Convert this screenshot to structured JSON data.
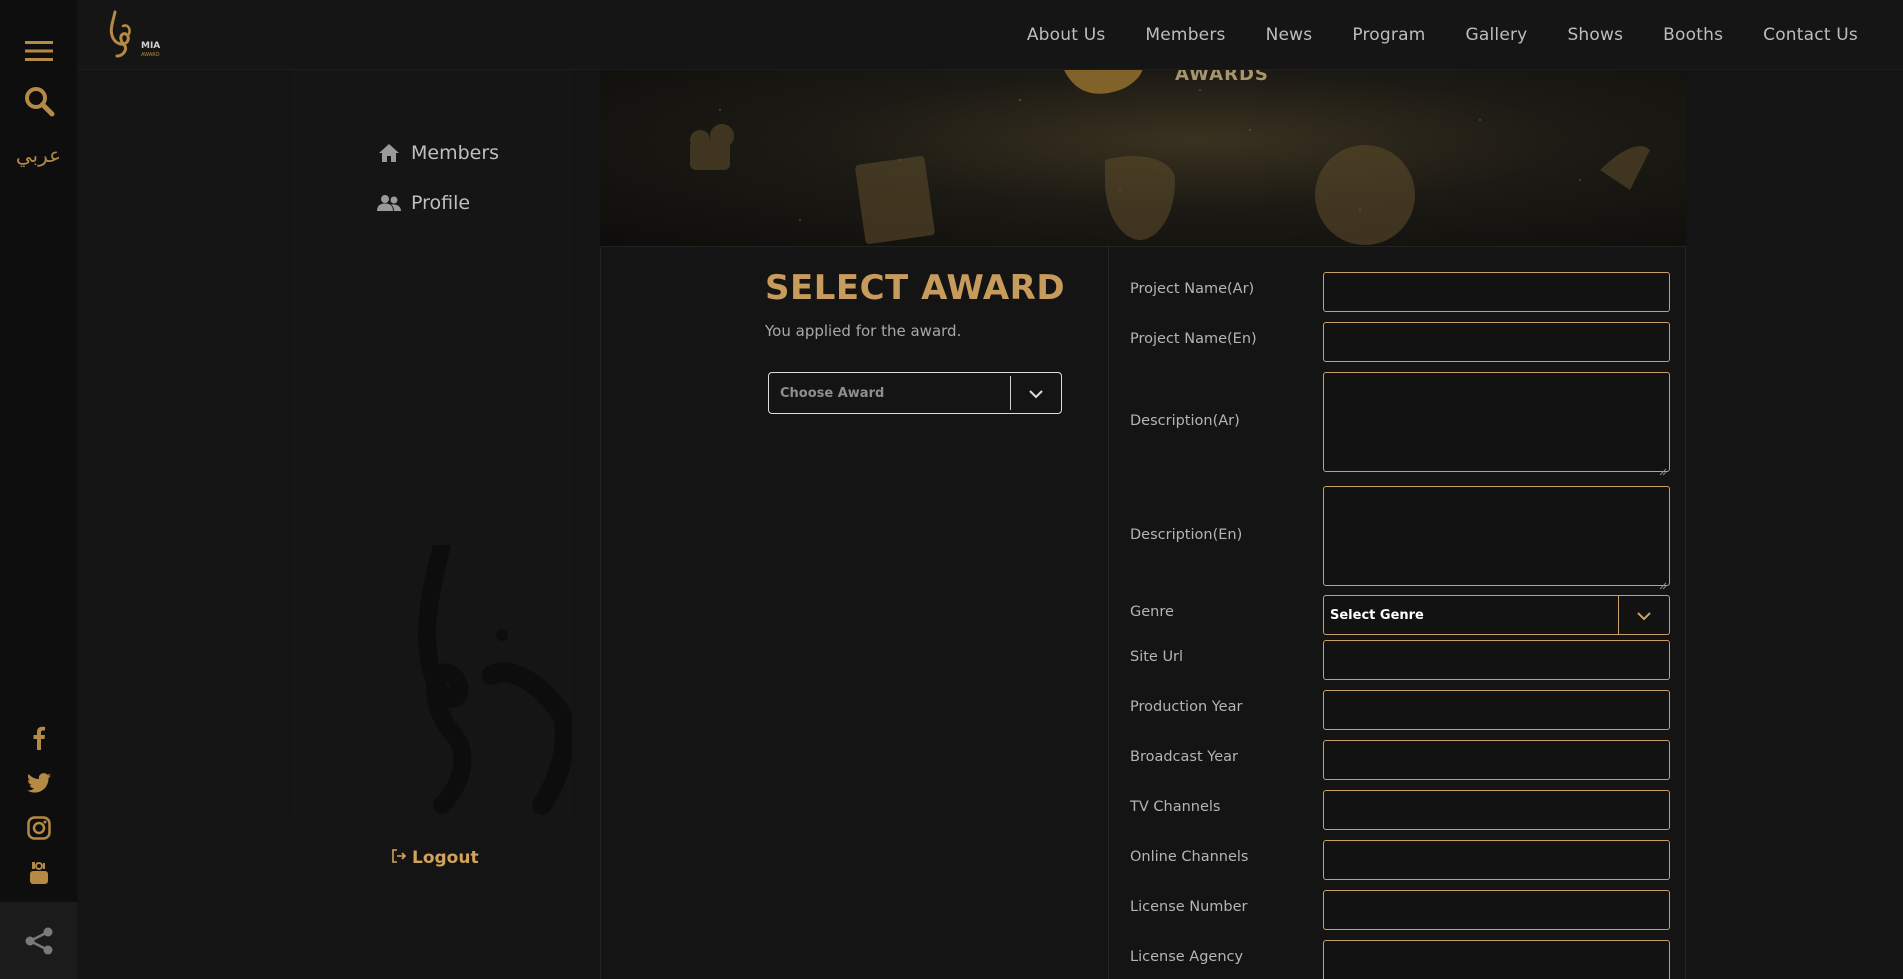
{
  "rail": {
    "lang_label": "عربي",
    "icons": [
      "menu-icon",
      "search-icon",
      "facebook-icon",
      "twitter-icon",
      "instagram-icon",
      "youtube-icon",
      "share-icon"
    ]
  },
  "logo": {
    "text": "MIA",
    "subtext": "AWARD"
  },
  "nav": {
    "items": [
      "About Us",
      "Members",
      "News",
      "Program",
      "Gallery",
      "Shows",
      "Booths",
      "Contact Us"
    ]
  },
  "side": {
    "members_label": "Members",
    "profile_label": "Profile",
    "logout_label": "Logout"
  },
  "banner": {
    "text": "AWARDS"
  },
  "award": {
    "title": "SELECT AWARD",
    "subtitle": "You applied for the award.",
    "select_value": "Choose Award"
  },
  "form": {
    "project_name_ar": "Project Name(Ar)",
    "project_name_en": "Project Name(En)",
    "description_ar": "Description(Ar)",
    "description_en": "Description(En)",
    "genre": "Genre",
    "genre_value": "Select Genre",
    "site_url": "Site Url",
    "production_year": "Production Year",
    "broadcast_year": "Broadcast Year",
    "tv_channels": "TV Channels",
    "online_channels": "Online Channels",
    "license_number": "License Number",
    "license_agency": "License Agency"
  },
  "colors": {
    "accent": "#c79b5c",
    "gold": "#b48a45",
    "border": "#c9a06a",
    "background": "#141414"
  }
}
